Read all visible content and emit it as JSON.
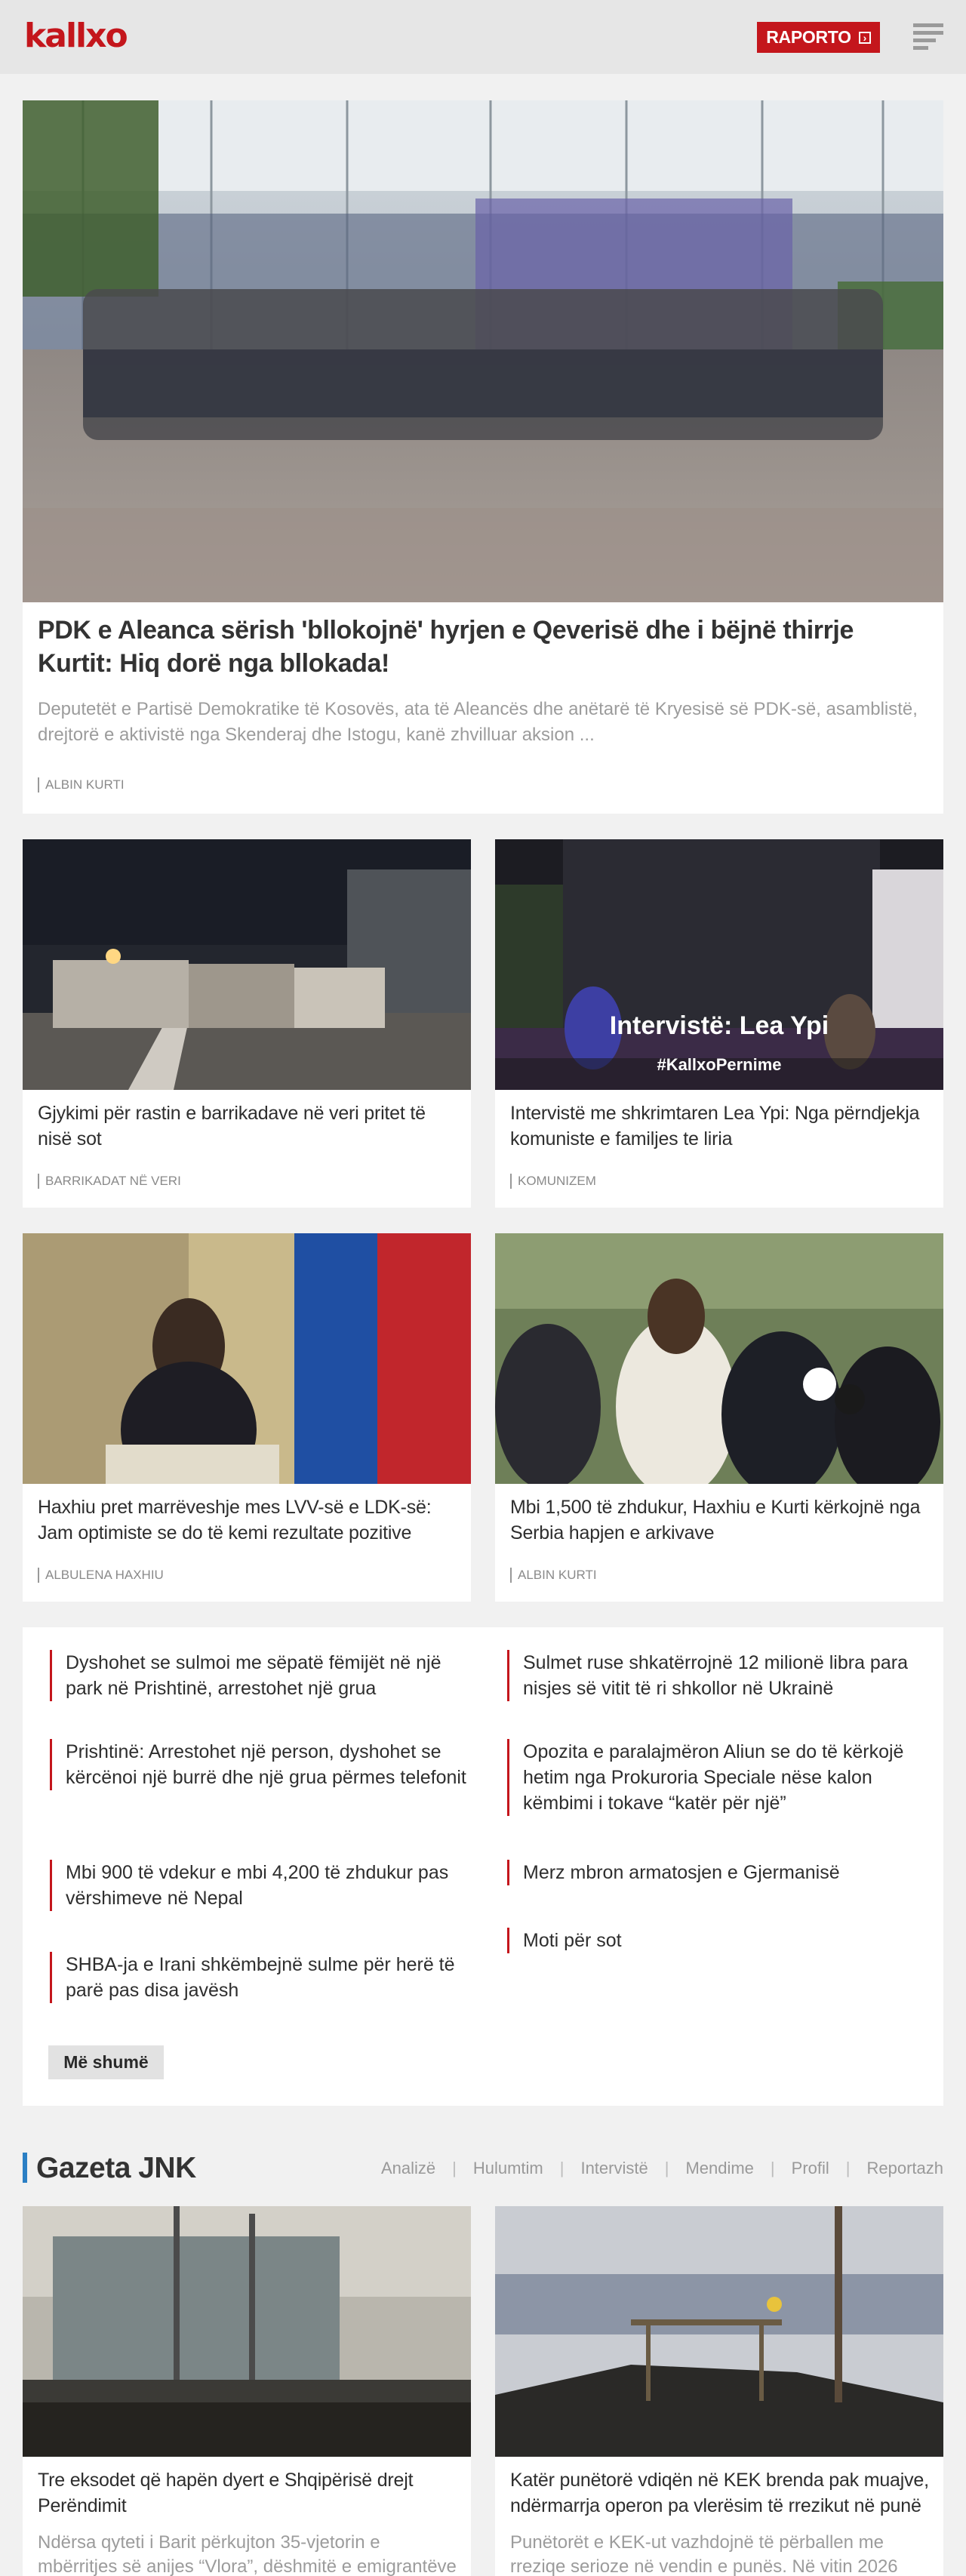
{
  "header": {
    "logo": "kallxo",
    "report_button": "RAPORTO",
    "report_arrow": "›"
  },
  "hero": {
    "title": "PDK e Aleanca sërish 'bllokojnë' hyrjen e Qeverisë dhe i bëjnë thirrje Kurtit: Hiq dorë nga bllokada!",
    "lead": "Deputetët e Partisë Demokratike të Kosovës, ata të Aleancës dhe anëtarë të Kryesisë së PDK-së, asamblistë, drejtorë e aktivistë nga Skenderaj dhe Istogu, kanë zhvilluar aksion ...",
    "tag": "Albin Kurti"
  },
  "grid": [
    {
      "title": "Gjykimi për rastin e barrikadave në veri pritet të nisë sot",
      "tag": "Barrikadat në veri"
    },
    {
      "title": "Intervistë me shkrimtaren Lea Ypi: Nga përndjekja komuniste e familjes te liria",
      "tag": "Komunizem",
      "overlay_title": "Intervistë: Lea Ypi",
      "overlay_hashtag": "#KallxoPernime"
    },
    {
      "title": "Haxhiu pret marrëveshje mes LVV-së e LDK-së: Jam optimiste se do të kemi rezultate pozitive",
      "tag": "Albulena Haxhiu"
    },
    {
      "title": "Mbi 1,500 të zhdukur, Haxhiu e Kurti kërkojnë nga Serbia hapjen e arkivave",
      "tag": "Albin Kurti"
    }
  ],
  "latest": {
    "items": [
      "Dyshohet se sulmoi me sëpatë fëmijët në një park në Prishtinë, arrestohet një grua",
      "Sulmet ruse shkatërrojnë 12 milionë libra para nisjes së vitit të ri shkollor në Ukrainë",
      "Prishtinë: Arrestohet një person, dyshohet se kërcënoi një burrë dhe një grua përmes telefonit",
      "Opozita e paralajmëron Aliun se do të kërkojë hetim nga Prokuroria Speciale nëse kalon këmbimi i tokave “katër për një”",
      "Mbi 900 të vdekur e mbi 4,200 të zhdukur pas vërshimeve në Nepal",
      "Merz mbron armatosjen e Gjermanisë",
      "SHBA-ja e Irani shkëmbejnë sulme për herë të parë pas disa javësh",
      "Moti për sot"
    ],
    "more_button": "Më shumë"
  },
  "gazeta": {
    "title": "Gazeta JNK",
    "nav": [
      "Analizë",
      "Hulumtim",
      "Intervistë",
      "Mendime",
      "Profil",
      "Reportazh"
    ],
    "cards": [
      {
        "title": "Tre eksodet që hapën dyert e Shqipërisë drejt Perëndimit",
        "lead": "Ndërsa qyteti i Barit përkujton 35-vjetorin e mbërritjes së anijes “Vlora”, dëshmitë e emigrantëve"
      },
      {
        "title": "Katër punëtorë vdiqën në KEK brenda pak muajve, ndërmarrja operon pa vlerësim të rrezikut në punë",
        "lead": "Punëtorët e KEK-ut vazhdojnë të përballen me rreziqe serioze në vendin e punës. Në vitin 2026 janë"
      }
    ]
  }
}
